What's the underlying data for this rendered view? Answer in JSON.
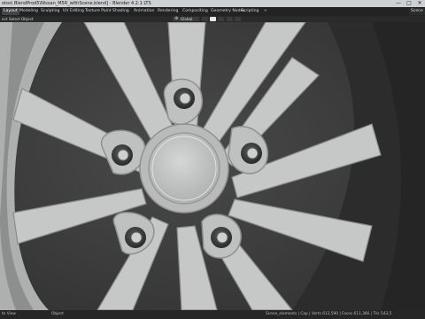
{
  "window": {
    "title": "otos\\ BlendProd5\\Nissan_M5R_withScene.blend] - Blender 4.2.1 LTS",
    "minimize": "—",
    "maximize": "□",
    "close": "✕"
  },
  "menu": {
    "tabs": [
      "Layout",
      "Modeling",
      "Sculpting",
      "UV Editing",
      "Texture Paint",
      "Shading",
      "Animation",
      "Rendering",
      "Compositing",
      "Geometry Nodes",
      "Scripting",
      "+"
    ],
    "active_tab": 0,
    "scene_label": "Scene"
  },
  "viewport_header": {
    "mode": "ect",
    "view": "Select",
    "add": "Object",
    "orientation": "Global",
    "orientation_icon": "global-icon"
  },
  "status": {
    "left": "te View",
    "mid": "Object",
    "right": "Scene_elements | Cap | Verts 612,590 | Faces 611,366 | Tris 543,5"
  },
  "colors": {
    "background": "#3d3d3d",
    "wheel": "#c8c9c9",
    "shadow": "#2a2a2a"
  }
}
